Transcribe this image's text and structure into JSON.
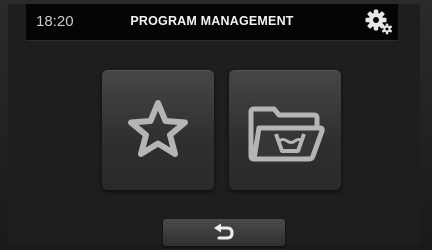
{
  "header": {
    "time": "18:20",
    "title": "PROGRAM MANAGEMENT",
    "settings_icon": "gears-icon"
  },
  "tiles": [
    {
      "name": "favorites",
      "icon": "star-icon"
    },
    {
      "name": "programs-folder",
      "icon": "wash-folder-icon"
    }
  ],
  "footer": {
    "back_icon": "return-arrow-icon"
  },
  "colors": {
    "background": "#1e1e1e",
    "header": "#050505",
    "tile": "#3a3a3a",
    "icon": "#b5b5b5",
    "text": "#f2f2f2"
  }
}
